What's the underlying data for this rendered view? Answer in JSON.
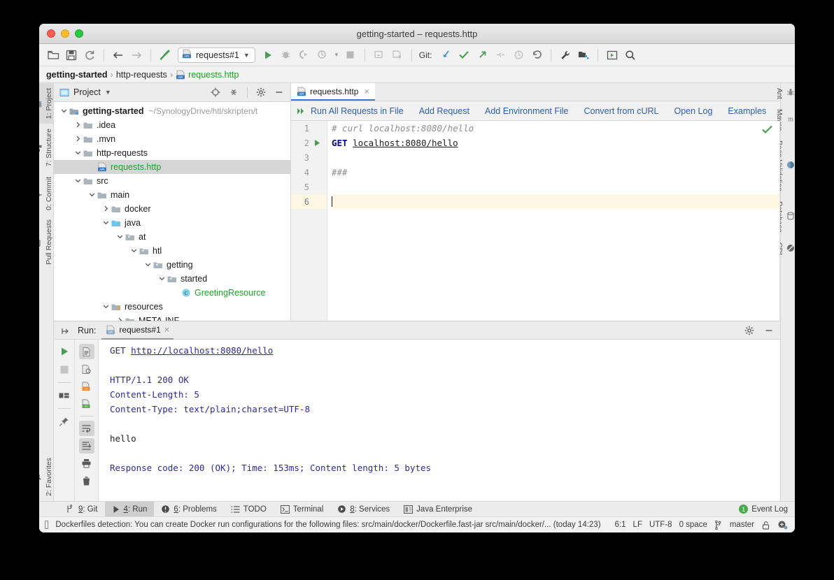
{
  "window": {
    "title": "getting-started – requests.http",
    "traffic_lights": [
      "close",
      "minimize",
      "zoom"
    ]
  },
  "toolbar": {
    "icons": [
      "open-folder-icon",
      "save-icon",
      "sync-icon",
      "back-arrow-icon",
      "forward-arrow-icon",
      "build-hammer-icon"
    ],
    "run_config": "requests#1",
    "run_icons": [
      "run-icon",
      "debug-icon",
      "run-coverage-icon",
      "profile-icon",
      "stop-icon"
    ],
    "extra_icons": [
      "attach-debugger-icon",
      "update-app-icon"
    ],
    "git_label": "Git:",
    "git_icons": [
      "update-project-icon",
      "commit-icon",
      "push-icon",
      "branch-diff-icon",
      "history-icon",
      "rollback-icon"
    ],
    "right_icons": [
      "settings-wrench-icon",
      "project-structure-icon",
      "run-anything-icon",
      "search-everywhere-icon"
    ]
  },
  "breadcrumb": {
    "items": [
      {
        "label": "getting-started",
        "style": "bold"
      },
      {
        "label": "http-requests",
        "style": "normal"
      },
      {
        "label": "requests.http",
        "style": "green",
        "icon": "http-file-icon"
      }
    ],
    "separator": "›"
  },
  "left_stripe": {
    "items": [
      {
        "label": "1: Project",
        "icon": "project-icon",
        "active": true
      },
      {
        "label": "7: Structure",
        "icon": "structure-icon",
        "active": false
      },
      {
        "label": "0: Commit",
        "icon": "commit-icon",
        "active": false
      },
      {
        "label": "Pull Requests",
        "icon": "pull-request-icon",
        "active": false
      }
    ],
    "bottom_items": [
      {
        "label": "2: Favorites",
        "icon": "star-icon",
        "active": false
      }
    ]
  },
  "right_stripe": {
    "items": [
      {
        "label": "Ant",
        "icon": "ant-icon"
      },
      {
        "label": "Maven",
        "icon": "maven-icon"
      },
      {
        "label": "Bean Validation",
        "icon": "bean-validation-icon"
      },
      {
        "label": "Database",
        "icon": "database-icon"
      },
      {
        "label": "CDI",
        "icon": "cdi-icon"
      }
    ]
  },
  "project_panel": {
    "title": "Project",
    "header_icons": [
      "locate-icon",
      "collapse-all-icon",
      "gear-icon",
      "hide-icon"
    ],
    "tree": [
      {
        "depth": 0,
        "arrow": "down",
        "icon": "module-icon",
        "label": "getting-started",
        "style": "bold",
        "path": "~/SynologyDrive/htl/skripten/t",
        "selected": false
      },
      {
        "depth": 1,
        "arrow": "right",
        "icon": "folder-icon",
        "label": ".idea",
        "style": "normal",
        "selected": false
      },
      {
        "depth": 1,
        "arrow": "right",
        "icon": "folder-icon",
        "label": ".mvn",
        "style": "normal",
        "selected": false
      },
      {
        "depth": 1,
        "arrow": "down",
        "icon": "folder-icon",
        "label": "http-requests",
        "style": "normal",
        "selected": false
      },
      {
        "depth": 2,
        "arrow": "none",
        "icon": "http-file-icon",
        "label": "requests.http",
        "style": "green",
        "selected": true
      },
      {
        "depth": 1,
        "arrow": "down",
        "icon": "folder-icon",
        "label": "src",
        "style": "normal",
        "selected": false
      },
      {
        "depth": 2,
        "arrow": "down",
        "icon": "folder-icon",
        "label": "main",
        "style": "normal",
        "selected": false
      },
      {
        "depth": 3,
        "arrow": "right",
        "icon": "folder-icon",
        "label": "docker",
        "style": "normal",
        "selected": false
      },
      {
        "depth": 3,
        "arrow": "down",
        "icon": "source-root-icon",
        "label": "java",
        "style": "normal",
        "selected": false
      },
      {
        "depth": 4,
        "arrow": "down",
        "icon": "package-icon",
        "label": "at",
        "style": "normal",
        "selected": false
      },
      {
        "depth": 5,
        "arrow": "down",
        "icon": "package-icon",
        "label": "htl",
        "style": "normal",
        "selected": false
      },
      {
        "depth": 6,
        "arrow": "down",
        "icon": "package-icon",
        "label": "getting",
        "style": "normal",
        "selected": false
      },
      {
        "depth": 7,
        "arrow": "down",
        "icon": "package-icon",
        "label": "started",
        "style": "normal",
        "selected": false
      },
      {
        "depth": 8,
        "arrow": "none",
        "icon": "java-class-icon",
        "label": "GreetingResource",
        "style": "green",
        "selected": false
      },
      {
        "depth": 3,
        "arrow": "down",
        "icon": "resource-root-icon",
        "label": "resources",
        "style": "normal",
        "selected": false
      },
      {
        "depth": 4,
        "arrow": "right",
        "icon": "folder-icon",
        "label": "META-INF",
        "style": "normal",
        "selected": false
      }
    ]
  },
  "editor": {
    "tab": {
      "label": "requests.http",
      "icon": "http-file-icon",
      "close": "×"
    },
    "http_toolbar": [
      {
        "label": "Run All Requests in File",
        "icon": "run-all-icon"
      },
      {
        "label": "Add Request",
        "icon": null
      },
      {
        "label": "Add Environment File",
        "icon": null
      },
      {
        "label": "Convert from cURL",
        "icon": null
      },
      {
        "label": "Open Log",
        "icon": null
      },
      {
        "label": "Examples",
        "icon": null
      }
    ],
    "inspection_status": "ok-checkmark",
    "lines": [
      {
        "number": "1",
        "gutter_icon": null,
        "current": false,
        "tokens": [
          {
            "t": "# curl localhost:8080/hello",
            "c": "comment"
          }
        ]
      },
      {
        "number": "2",
        "gutter_icon": "run-icon",
        "current": false,
        "tokens": [
          {
            "t": "GET ",
            "c": "method"
          },
          {
            "t": "localhost:8080/hello",
            "c": "url"
          }
        ]
      },
      {
        "number": "3",
        "gutter_icon": null,
        "current": false,
        "tokens": []
      },
      {
        "number": "4",
        "gutter_icon": null,
        "current": false,
        "tokens": [
          {
            "t": "###",
            "c": "comment"
          }
        ]
      },
      {
        "number": "5",
        "gutter_icon": null,
        "current": false,
        "tokens": []
      },
      {
        "number": "6",
        "gutter_icon": null,
        "current": true,
        "tokens": [
          {
            "t": "",
            "c": "caret"
          }
        ]
      }
    ]
  },
  "run_panel": {
    "label": "Run:",
    "tab": {
      "label": "requests#1",
      "icon": "http-file-icon",
      "close": "×"
    },
    "header_icons": [
      "gear-icon",
      "hide-icon"
    ],
    "side_icons": [
      "rerun-icon",
      "stop-icon",
      "layout-icon",
      "pin-icon"
    ],
    "side_icons2": [
      "response-body-icon",
      "response-headers-icon",
      "format-xml-icon",
      "format-html-icon",
      "soft-wrap-icon",
      "scroll-to-end-icon",
      "print-icon",
      "delete-icon"
    ],
    "console": [
      {
        "text": "GET http://localhost:8080/hello",
        "parts": [
          {
            "t": "GET ",
            "c": "blue"
          },
          {
            "t": "http://localhost:8080/hello",
            "c": "link"
          }
        ]
      },
      {
        "text": "",
        "parts": []
      },
      {
        "text": "HTTP/1.1 200 OK",
        "parts": [
          {
            "t": "HTTP/1.1 200 OK",
            "c": "blue"
          }
        ]
      },
      {
        "text": "Content-Length: 5",
        "parts": [
          {
            "t": "Content-Length: 5",
            "c": "blue"
          }
        ]
      },
      {
        "text": "Content-Type: text/plain;charset=UTF-8",
        "parts": [
          {
            "t": "Content-Type: text/plain;charset=UTF-8",
            "c": "blue"
          }
        ]
      },
      {
        "text": "",
        "parts": []
      },
      {
        "text": "hello",
        "parts": [
          {
            "t": "hello",
            "c": "plain"
          }
        ]
      },
      {
        "text": "",
        "parts": []
      },
      {
        "text": "Response code: 200 (OK); Time: 153ms; Content length: 5 bytes",
        "parts": [
          {
            "t": "Response code: 200 (OK); Time: 153ms; Content length: 5 bytes",
            "c": "blue"
          }
        ]
      }
    ]
  },
  "tool_strip": {
    "items": [
      {
        "label": "9: Git",
        "mnemonic": "9",
        "icon": "git-icon",
        "active": false
      },
      {
        "label": "4: Run",
        "mnemonic": "4",
        "icon": "run-icon",
        "active": true
      },
      {
        "label": "6: Problems",
        "mnemonic": "6",
        "icon": "problems-icon",
        "active": false
      },
      {
        "label": "TODO",
        "mnemonic": "",
        "icon": "todo-icon",
        "active": false
      },
      {
        "label": "Terminal",
        "mnemonic": "",
        "icon": "terminal-icon",
        "active": false
      },
      {
        "label": "8: Services",
        "mnemonic": "8",
        "icon": "services-icon",
        "active": false
      },
      {
        "label": "Java Enterprise",
        "mnemonic": "",
        "icon": "java-enterprise-icon",
        "active": false
      }
    ],
    "event_log": {
      "label": "Event Log",
      "badge": "1"
    }
  },
  "status_bar": {
    "message": "Dockerfiles detection: You can create Docker run configurations for the following files: src/main/docker/Dockerfile.fast-jar src/main/docker/... (today 14:23)",
    "caret": "6:1",
    "line_separator": "LF",
    "encoding": "UTF-8",
    "indent": "0 space",
    "branch": "master",
    "branch_icon": "git-branch-icon",
    "lock_icon": "unlocked-icon",
    "inspection_icon": "inspection-level-icon"
  },
  "colors": {
    "accent_blue": "#2d5fa8",
    "green": "#22a02a",
    "tab_underline": "#3b7bbf",
    "caret_line": "#fdf8e3",
    "selection": "#d6d6d6"
  }
}
